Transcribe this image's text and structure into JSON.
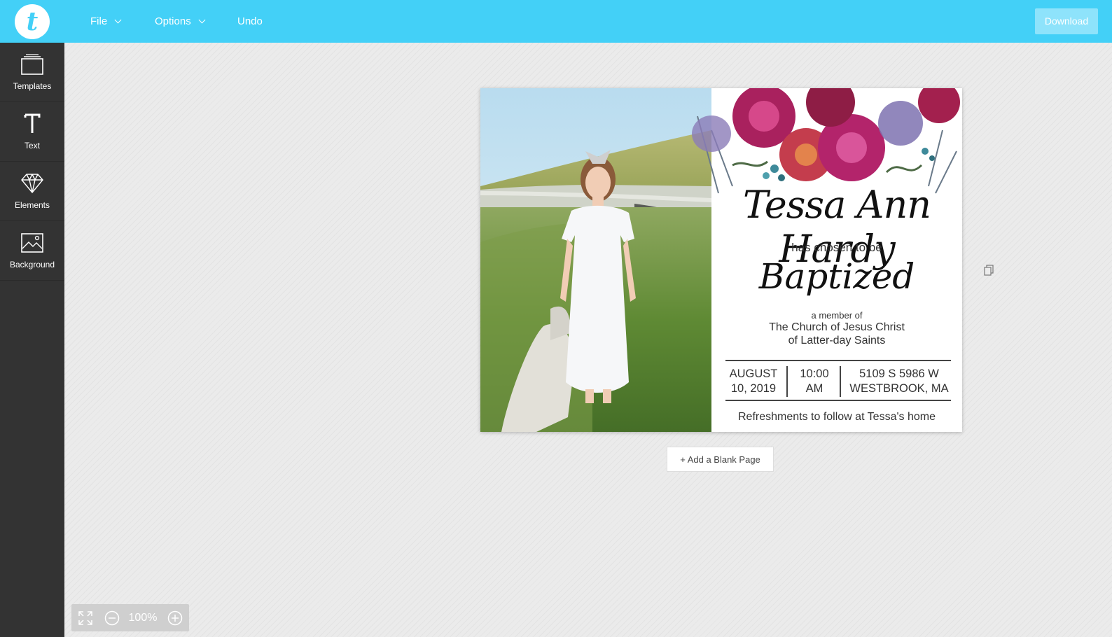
{
  "app": {
    "logo_letter": "t",
    "accent_color": "#43d0f7"
  },
  "topbar": {
    "menu": [
      {
        "label": "File",
        "has_dropdown": true
      },
      {
        "label": "Options",
        "has_dropdown": true
      },
      {
        "label": "Undo",
        "has_dropdown": false
      }
    ],
    "download_label": "Download"
  },
  "sidebar": {
    "items": [
      {
        "label": "Templates",
        "icon": "templates-icon"
      },
      {
        "label": "Text",
        "icon": "text-icon"
      },
      {
        "label": "Elements",
        "icon": "diamond-icon"
      },
      {
        "label": "Background",
        "icon": "background-image-icon"
      }
    ]
  },
  "card": {
    "name": "Tessa Ann Hardy",
    "chosen_line": "has chosen to be",
    "baptized": "Baptized",
    "member_line": "a member of",
    "church_line1": "The Church of Jesus Christ",
    "church_line2": "of Latter-day Saints",
    "date_line1": "AUGUST",
    "date_line2": "10, 2019",
    "time_line1": "10:00",
    "time_line2": "AM",
    "address_line1": "5109 S 5986 W",
    "address_line2": "WESTBROOK, MA",
    "refreshments": "Refreshments to follow at Tessa's home"
  },
  "add_page_label": "+ Add a Blank Page",
  "zoom": {
    "level": "100%"
  }
}
